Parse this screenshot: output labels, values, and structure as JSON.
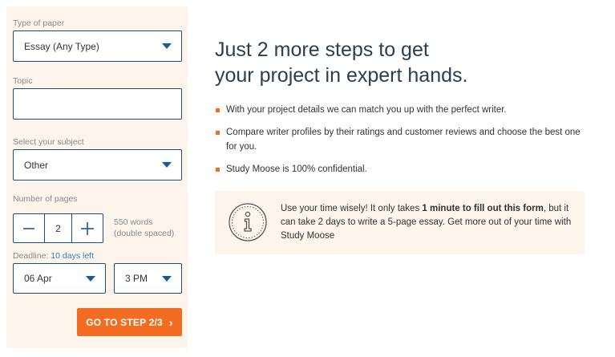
{
  "form": {
    "paper_type": {
      "label": "Type of paper",
      "value": "Essay (Any Type)"
    },
    "topic": {
      "label": "Topic",
      "value": ""
    },
    "subject": {
      "label": "Select your subject",
      "value": "Other"
    },
    "pages": {
      "label": "Number of pages",
      "value": "2",
      "minus": "—",
      "plus": "+",
      "words": "550 words",
      "spacing": "(double spaced)"
    },
    "deadline": {
      "label": "Deadline:",
      "left": "10 days left",
      "date": "06 Apr",
      "time": "3 PM"
    },
    "submit_label": "GO TO STEP 2/3",
    "submit_chevron": "›"
  },
  "content": {
    "headline_line1": "Just 2 more steps to get",
    "headline_line2": "your project in expert hands.",
    "bullets": [
      "With your project details we can match you up with the perfect writer.",
      "Compare writer profiles by their ratings and customer reviews and choose the best one for you.",
      "Study Moose is 100% confidential."
    ],
    "note": {
      "part1": "Use your time wisely! It only takes ",
      "bold": "1 minute to fill out this form",
      "part2": ", but it can take 2 days to write a 5-page essay. Get more out of your time with Study Moose"
    }
  },
  "colors": {
    "accent": "#f26d21",
    "border": "#1a4e7c",
    "panel": "#fdf4ec",
    "heading": "#2c3e50"
  },
  "icons": [
    "chevron-down-icon",
    "minus-icon",
    "plus-icon",
    "info-icon"
  ]
}
